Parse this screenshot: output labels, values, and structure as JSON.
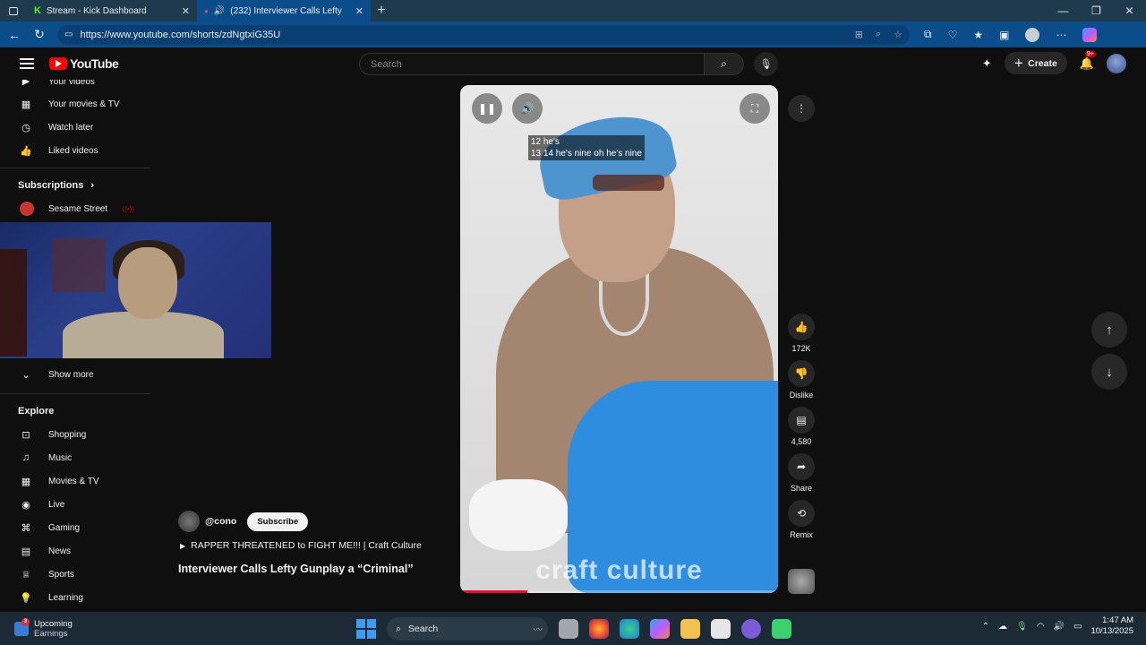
{
  "browser": {
    "tabs": [
      {
        "label": "Stream - Kick Dashboard",
        "active": false
      },
      {
        "label": "(232) Interviewer Calls Lefty",
        "active": true
      }
    ],
    "url": "https://www.youtube.com/shorts/zdNgtxiG35U"
  },
  "youtube": {
    "logo_text": "YouTube",
    "search_placeholder": "Search",
    "create_label": "Create",
    "notification_badge": "9+"
  },
  "sidebar": {
    "top_items": [
      {
        "label": "Your videos",
        "icon": "video-icon"
      },
      {
        "label": "Your movies & TV",
        "icon": "film-icon"
      },
      {
        "label": "Watch later",
        "icon": "clock-icon"
      },
      {
        "label": "Liked videos",
        "icon": "thumbs-up-icon"
      }
    ],
    "subscriptions_heading": "Subscriptions",
    "subscriptions": [
      {
        "label": "Sesame Street"
      }
    ],
    "show_more": "Show more",
    "explore_heading": "Explore",
    "explore_items": [
      {
        "label": "Shopping",
        "icon": "shopping-bag-icon"
      },
      {
        "label": "Music",
        "icon": "music-note-icon"
      },
      {
        "label": "Movies & TV",
        "icon": "film-icon"
      },
      {
        "label": "Live",
        "icon": "live-icon"
      },
      {
        "label": "Gaming",
        "icon": "gamepad-icon"
      },
      {
        "label": "News",
        "icon": "newspaper-icon"
      },
      {
        "label": "Sports",
        "icon": "trophy-icon"
      },
      {
        "label": "Learning",
        "icon": "lightbulb-icon"
      }
    ]
  },
  "short": {
    "caption_line1": "12 he's",
    "caption_line2": "13 14 he's nine oh he's nine",
    "watermark": "craft culture",
    "progress_fraction": 0.21,
    "channel": "@cono",
    "subscribe_label": "Subscribe",
    "playlist": "RAPPER THREATENED to FIGHT ME!!! | Craft Culture",
    "title": "Interviewer Calls Lefty Gunplay a “Criminal”"
  },
  "actions": {
    "like_count": "172K",
    "dislike_label": "Dislike",
    "comment_count": "4,580",
    "share_label": "Share",
    "remix_label": "Remix"
  },
  "taskbar": {
    "weather_title": "Upcoming",
    "weather_sub": "Earnings",
    "weather_badge": "3",
    "search_label": "Search",
    "time": "1:47 AM",
    "date": "10/13/2025"
  }
}
